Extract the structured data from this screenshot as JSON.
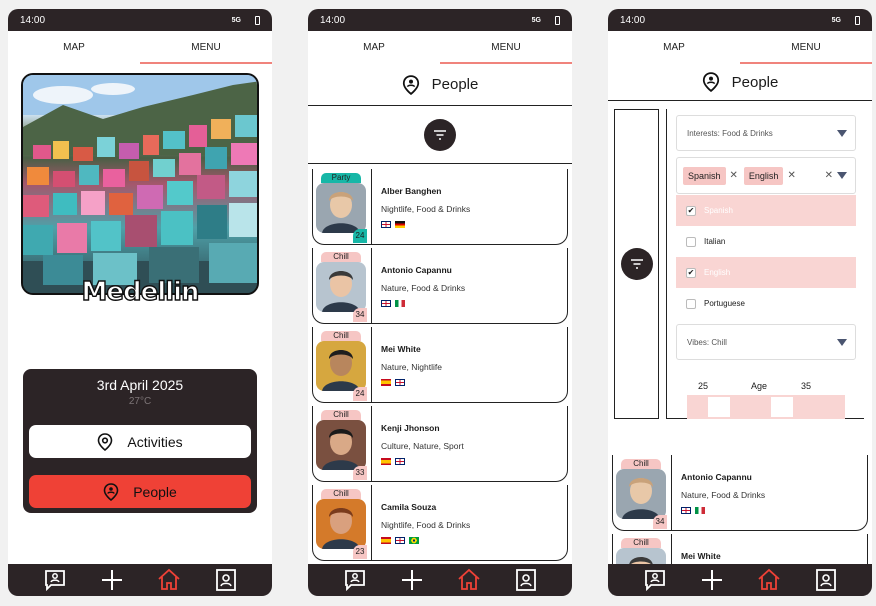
{
  "status": {
    "time": "14:00",
    "signal": "5G"
  },
  "tabs": {
    "map": "MAP",
    "menu": "MENU"
  },
  "home": {
    "city": "Medellin",
    "date": "3rd April 2025",
    "temperature": "27°C",
    "activities_label": "Activities",
    "people_label": "People"
  },
  "people_page": {
    "title": "People"
  },
  "people": [
    {
      "vibe": "Party",
      "name": "Alber Banghen",
      "interests": "Nightlife, Food & Drinks",
      "age": "24",
      "flags": [
        "uk",
        "de"
      ]
    },
    {
      "vibe": "Chill",
      "name": "Antonio Capannu",
      "interests": "Nature, Food & Drinks",
      "age": "34",
      "flags": [
        "uk",
        "it"
      ]
    },
    {
      "vibe": "Chill",
      "name": "Mei White",
      "interests": "Nature, Nightlife",
      "age": "24",
      "flags": [
        "es",
        "uk"
      ]
    },
    {
      "vibe": "Chill",
      "name": "Kenji Jhonson",
      "interests": "Culture, Nature, Sport",
      "age": "33",
      "flags": [
        "es",
        "uk"
      ]
    },
    {
      "vibe": "Chill",
      "name": "Camila Souza",
      "interests": "Nightlife, Food & Drinks",
      "age": "23",
      "flags": [
        "es",
        "uk",
        "br"
      ]
    }
  ],
  "filters": {
    "interests": "Interests: Food & Drinks",
    "languages_selected": [
      "Spanish",
      "English"
    ],
    "language_options": [
      {
        "label": "Spanish",
        "checked": true
      },
      {
        "label": "Italian",
        "checked": false
      },
      {
        "label": "English",
        "checked": true
      },
      {
        "label": "Portuguese",
        "checked": false
      }
    ],
    "vibes": "Vibes: Chill",
    "age_label": "Age",
    "age_min": "25",
    "age_max": "35"
  },
  "filtered_people": [
    {
      "vibe": "Chill",
      "name": "Antonio Capannu",
      "interests": "Nature, Food & Drinks",
      "age": "34",
      "flags": [
        "uk",
        "it"
      ]
    },
    {
      "vibe": "Chill",
      "name": "Mei White",
      "interests": "",
      "age": "",
      "flags": []
    }
  ],
  "icons": {
    "nav": [
      "chat-icon",
      "plus-icon",
      "home-icon",
      "profile-icon"
    ],
    "colors": {
      "dark": "#2c2426",
      "accent_red": "#ef4136",
      "chill_pink": "#f6c6c4",
      "party_teal": "#17b7a7"
    }
  }
}
